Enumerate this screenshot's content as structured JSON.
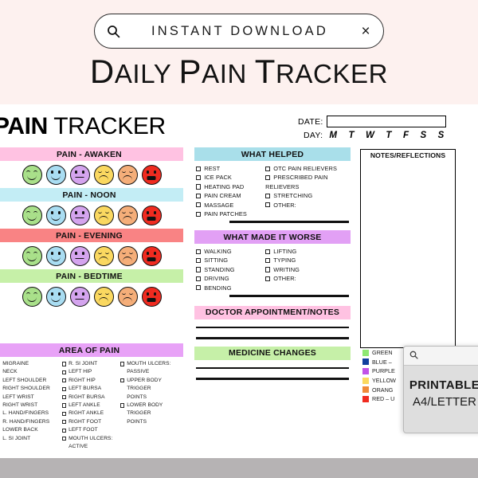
{
  "promo": {
    "badge_label": "INSTANT DOWNLOAD",
    "search_icon": "search-icon",
    "close_icon": "close-icon",
    "title_lead": "D",
    "title": "AILY ",
    "title_p": "P",
    "title_ain": "AIN ",
    "title_t": "T",
    "title_racker": "RACKER"
  },
  "card": {
    "title_bold": "PAIN",
    "title_light": " TRACKER",
    "date_label": "DATE:",
    "day_label": "DAY:",
    "day_letters": [
      "M",
      "T",
      "W",
      "T",
      "F",
      "S",
      "S"
    ],
    "notes_label": "NOTES/REFLECTIONS"
  },
  "pain_sections": [
    {
      "label": "PAIN - AWAKEN",
      "color": "#FFC2E2"
    },
    {
      "label": "PAIN - NOON",
      "color": "#C3EDF5"
    },
    {
      "label": "PAIN - EVENING",
      "color": "#F98384"
    },
    {
      "label": "PAIN - BEDTIME",
      "color": "#C6F0A8"
    }
  ],
  "faces": [
    {
      "name": "face-no-pain",
      "color": "#A9E08A",
      "eyes": "closed-up",
      "mouth": "smile"
    },
    {
      "name": "face-mild-pain",
      "color": "#A9DDF2",
      "eyes": "dots",
      "mouth": "smile"
    },
    {
      "name": "face-moderate-pain",
      "color": "#D4A4EE",
      "eyes": "dots",
      "mouth": "flat"
    },
    {
      "name": "face-severe-pain",
      "color": "#FAD860",
      "eyes": "closed-dn",
      "mouth": "frown"
    },
    {
      "name": "face-very-severe",
      "color": "#F5AE79",
      "eyes": "closed-dn",
      "mouth": "frown"
    },
    {
      "name": "face-worst-pain",
      "color": "#F02B20",
      "eyes": "dots",
      "mouth": "grim"
    }
  ],
  "what_helped": {
    "title": "WHAT HELPED",
    "color": "#A9DFEA",
    "col_a": [
      "REST",
      "ICE PACK",
      "HEATING PAD",
      "PAIN CREAM",
      "MASSAGE",
      "PAIN PATCHES"
    ],
    "col_b": [
      "OTC PAIN RELIEVERS",
      "PRESCRIBED PAIN",
      "STRETCHING",
      "OTHER:"
    ],
    "col_b_cont": "RELIEVERS"
  },
  "what_worse": {
    "title": "WHAT MADE IT WORSE",
    "color": "#E2A0F5",
    "col_a": [
      "WALKING",
      "SITTING",
      "STANDING",
      "DRIVING",
      "BENDING"
    ],
    "col_b": [
      "LIFTING",
      "TYPING",
      "WRITING",
      "OTHER:"
    ]
  },
  "doctor": {
    "title": "DOCTOR APPOINTMENT/NOTES",
    "color": "#FFC2E2",
    "lines": 2
  },
  "medicine": {
    "title": "MEDICINE CHANGES",
    "color": "#C6F0A8",
    "lines": 2
  },
  "area_of_pain": {
    "title": "AREA OF PAIN",
    "color": "#E8A2F7",
    "col1": [
      "MIGRAINE",
      "NECK",
      "LEFT SHOULDER",
      "RIGHT SHOULDER",
      "LEFT WRIST",
      "RIGHT WRIST",
      "L. HAND/FINGERS",
      "R. HAND/FINGERS",
      "LOWER BACK",
      "L. SI JOINT"
    ],
    "col2": [
      "R. SI JOINT",
      "LEFT HIP",
      "RIGHT HIP",
      "LEFT BURSA",
      "RIGHT BURSA",
      "LEFT ANKLE",
      "RIGHT ANKLE",
      "RIGHT FOOT",
      "LEFT FOOT",
      "MOUTH ULCERS: ACTIVE"
    ],
    "col3": [
      "MOUTH ULCERS:",
      "UPPER BODY TRIGGER",
      "LOWER BODY TRIGGER"
    ],
    "col3_cont": [
      "PASSIVE",
      "POINTS",
      "POINTS"
    ]
  },
  "legend": [
    {
      "label": "GREEN",
      "color": "#8FE873"
    },
    {
      "label": "BLUE –",
      "color": "#103F9E"
    },
    {
      "label": "PURPLE",
      "color": "#C152E8"
    },
    {
      "label": "YELLOW",
      "color": "#FBD95E"
    },
    {
      "label": "ORANG",
      "color": "#F08A39"
    },
    {
      "label": "RED – U",
      "color": "#F02B20"
    }
  ],
  "overlay": {
    "search_icon": "search-icon",
    "line1": "PRINTABLE",
    "line2": "A4/LETTER"
  }
}
